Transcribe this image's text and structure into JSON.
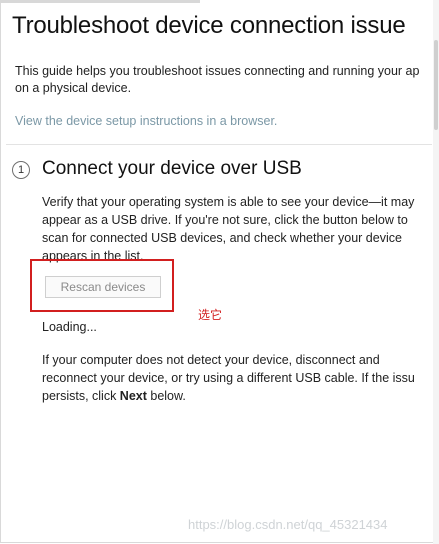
{
  "page": {
    "title": "Troubleshoot device connection issue",
    "intro_line1": "This guide helps you troubleshoot issues connecting and running your ap",
    "intro_line2": "on a physical device.",
    "setup_link": "View the device setup instructions in a browser."
  },
  "step": {
    "number": "1",
    "title": "Connect your device over USB",
    "paragraph_lines": [
      "Verify that your operating system is able to see your device—it may",
      "appear as a USB drive. If you're not sure, click the button below to",
      "scan for connected USB devices, and check whether your device",
      "appears in the list."
    ],
    "rescan_button": "Rescan devices",
    "loading": "Loading...",
    "footer_lines": [
      "If your computer does not detect your device, disconnect and",
      "reconnect your device, or try using a different USB cable. If the issu",
      "persists, click ",
      "Next",
      " below."
    ]
  },
  "annotation": {
    "text": "选它",
    "color": "#d21f1f"
  },
  "watermark": "https://blog.csdn.net/qq_45321434",
  "colors": {
    "link": "#7b98a6",
    "highlight_box": "#d21f1f"
  }
}
